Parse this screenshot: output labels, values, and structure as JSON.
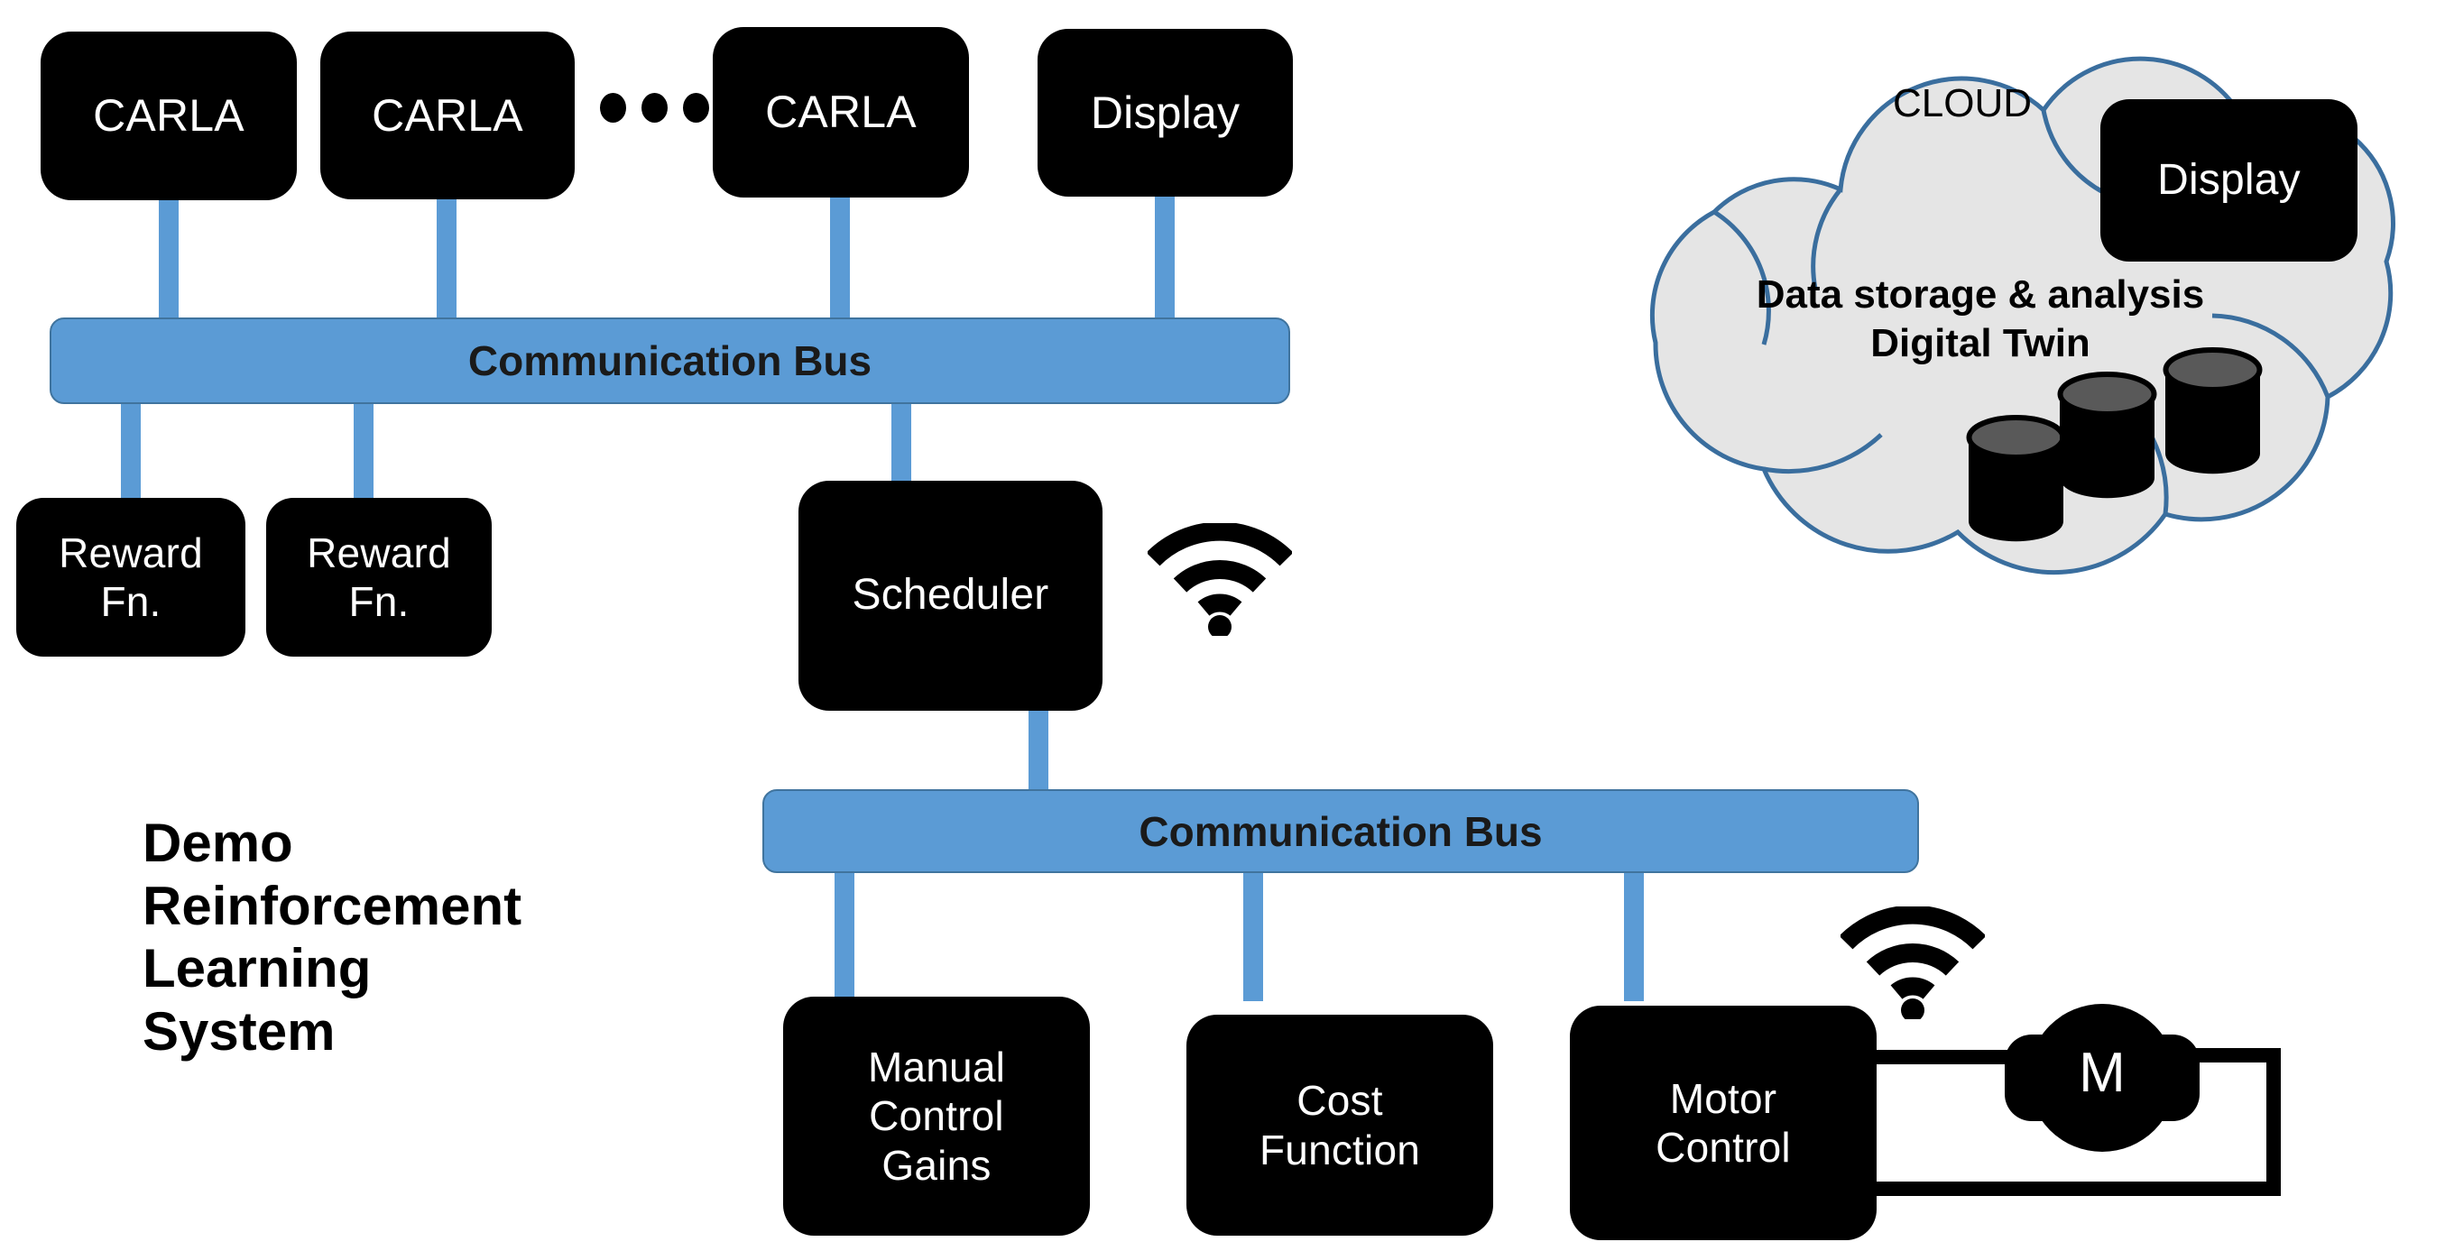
{
  "diagram": {
    "title": "Demo Reinforcement Learning System",
    "caption": "Demo\nReinforcement\nLearning\nSystem",
    "colors": {
      "bus_blue": "#5B9BD5",
      "bus_border": "#40749E",
      "node_black": "#000000",
      "node_text": "#FFFFFF",
      "cloud_fill": "#E5E5E5",
      "cloud_stroke": "#3A6E9E",
      "cylinder_top": "#595959",
      "background": "#FFFFFF"
    },
    "top_row": [
      {
        "label": "CARLA"
      },
      {
        "label": "CARLA"
      },
      {
        "label": "CARLA"
      },
      {
        "label": "Display"
      }
    ],
    "ellipsis": "•••",
    "buses": [
      {
        "label": "Communication Bus"
      },
      {
        "label": "Communication Bus"
      }
    ],
    "reward_nodes": [
      {
        "label": "Reward\nFn."
      },
      {
        "label": "Reward\nFn."
      }
    ],
    "scheduler": {
      "label": "Scheduler"
    },
    "bottom_row": [
      {
        "label": "Manual\nControl\nGains"
      },
      {
        "label": "Cost\nFunction"
      },
      {
        "label": "Motor\nControl"
      }
    ],
    "motor": {
      "label": "M"
    },
    "cloud": {
      "title": "CLOUD",
      "subtitle": "Data storage & analysis\nDigital Twin",
      "display": {
        "label": "Display"
      },
      "database_count": 3
    },
    "icons": {
      "wifi_scheduler": "wifi-icon",
      "wifi_motor": "wifi-icon",
      "databases": "database-cylinder-icon",
      "cloud_shape": "cloud-icon"
    }
  }
}
